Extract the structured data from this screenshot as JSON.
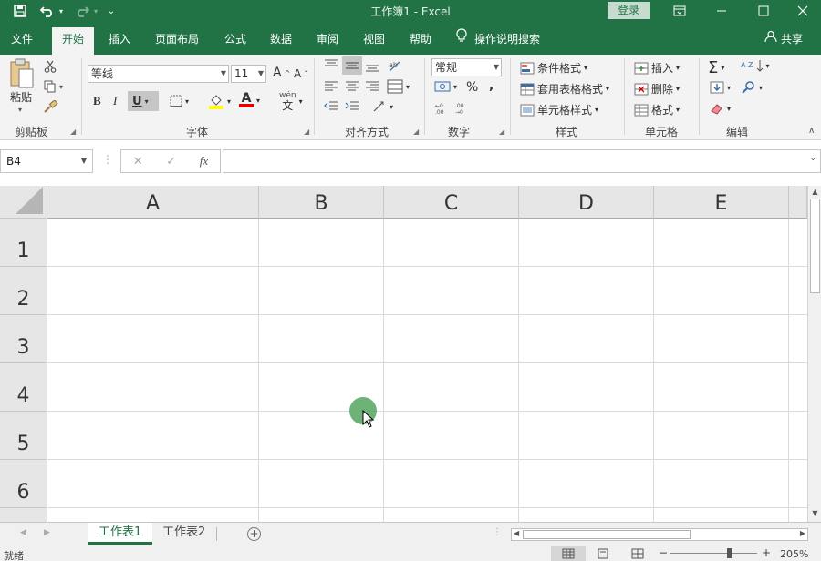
{
  "window": {
    "title": "工作簿1  -  Excel",
    "login_label": "登录",
    "accent_color": "#217346"
  },
  "quick_access": {
    "save_icon": "save-icon",
    "undo_icon": "undo-icon",
    "redo_icon": "redo-icon",
    "customize_icon": "customize-icon"
  },
  "ribbon_tabs": [
    "文件",
    "开始",
    "插入",
    "页面布局",
    "公式",
    "数据",
    "审阅",
    "视图",
    "帮助"
  ],
  "active_tab": "开始",
  "tell_me": "操作说明搜索",
  "share_label": "共享",
  "clipboard": {
    "paste_label": "粘贴",
    "group_label": "剪贴板"
  },
  "font": {
    "name": "等线",
    "size": "11",
    "bold": "B",
    "italic": "I",
    "underline": "U",
    "increase": "A",
    "decrease": "A",
    "font_color_letter": "A",
    "phonetic": "wén",
    "phonetic_char": "文",
    "group_label": "字体"
  },
  "alignment": {
    "group_label": "对齐方式"
  },
  "number": {
    "format": "常规",
    "percent": "%",
    "comma": ",",
    "group_label": "数字"
  },
  "styles": {
    "conditional": "条件格式",
    "table": "套用表格格式",
    "cell": "单元格样式",
    "group_label": "样式"
  },
  "cells": {
    "insert": "插入",
    "delete": "删除",
    "format": "格式",
    "group_label": "单元格"
  },
  "editing": {
    "sort_label": "A Z",
    "group_label": "编辑"
  },
  "formula_bar": {
    "name_box": "B4",
    "fx": "fx",
    "cancel": "✕",
    "enter": "✓",
    "value": ""
  },
  "columns": [
    "A",
    "B",
    "C",
    "D",
    "E"
  ],
  "rows": [
    "1",
    "2",
    "3",
    "4",
    "5",
    "6"
  ],
  "sheets": [
    "工作表1",
    "工作表2"
  ],
  "active_sheet": "工作表1",
  "status": {
    "ready": "就绪",
    "zoom": "205%",
    "zoom_minus": "−",
    "zoom_plus": "+"
  }
}
